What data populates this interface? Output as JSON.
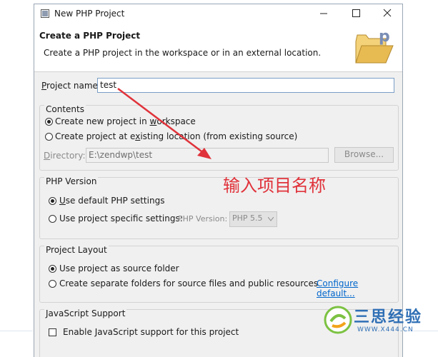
{
  "window": {
    "title": "New PHP Project",
    "icons": {
      "app": "php-wizard-icon",
      "minimize": "minimize-icon",
      "maximize": "maximize-icon",
      "close": "close-icon"
    }
  },
  "banner": {
    "title": "Create a PHP Project",
    "description": "Create a PHP project in the workspace or in an external location.",
    "icon": "php-folder-icon"
  },
  "project_name": {
    "label_pre": "",
    "label_mnemonic": "P",
    "label_post": "roject name:",
    "value": "test"
  },
  "contents": {
    "label": "Contents",
    "new_project": {
      "pre": "Create new project in ",
      "mnemonic": "w",
      "post": "orkspace",
      "selected": true
    },
    "existing": {
      "pre": "Create project at e",
      "mnemonic": "x",
      "post": "isting location (from existing source)",
      "selected": false
    },
    "directory_label_mnemonic": "D",
    "directory_label_post": "irectory:",
    "directory_value": "E:\\zendwp\\test",
    "browse_label": "Browse..."
  },
  "php_version": {
    "label": "PHP Version",
    "default": {
      "pre": "",
      "mnemonic": "U",
      "post": "se default PHP settings",
      "selected": true
    },
    "specific": {
      "label": "Use project specific settings:",
      "selected": false
    },
    "version_label": "PHP Version:",
    "version_value": "PHP 5.5"
  },
  "project_layout": {
    "label": "Project Layout",
    "source_folder": {
      "label": "Use project as source folder",
      "selected": true
    },
    "separate": {
      "label": "Create separate folders for source files and public resources",
      "selected": false
    },
    "configure_link": "Configure default..."
  },
  "javascript": {
    "label": "JavaScript Support",
    "checkbox_label": "Enable JavaScript support for this project",
    "checked": false
  },
  "annotation": {
    "text": "输入项目名称",
    "color": "#e0323a"
  },
  "watermark": {
    "text": "三思经验",
    "url": "WWW.X444.CN",
    "icon": "sansi-logo-icon"
  }
}
